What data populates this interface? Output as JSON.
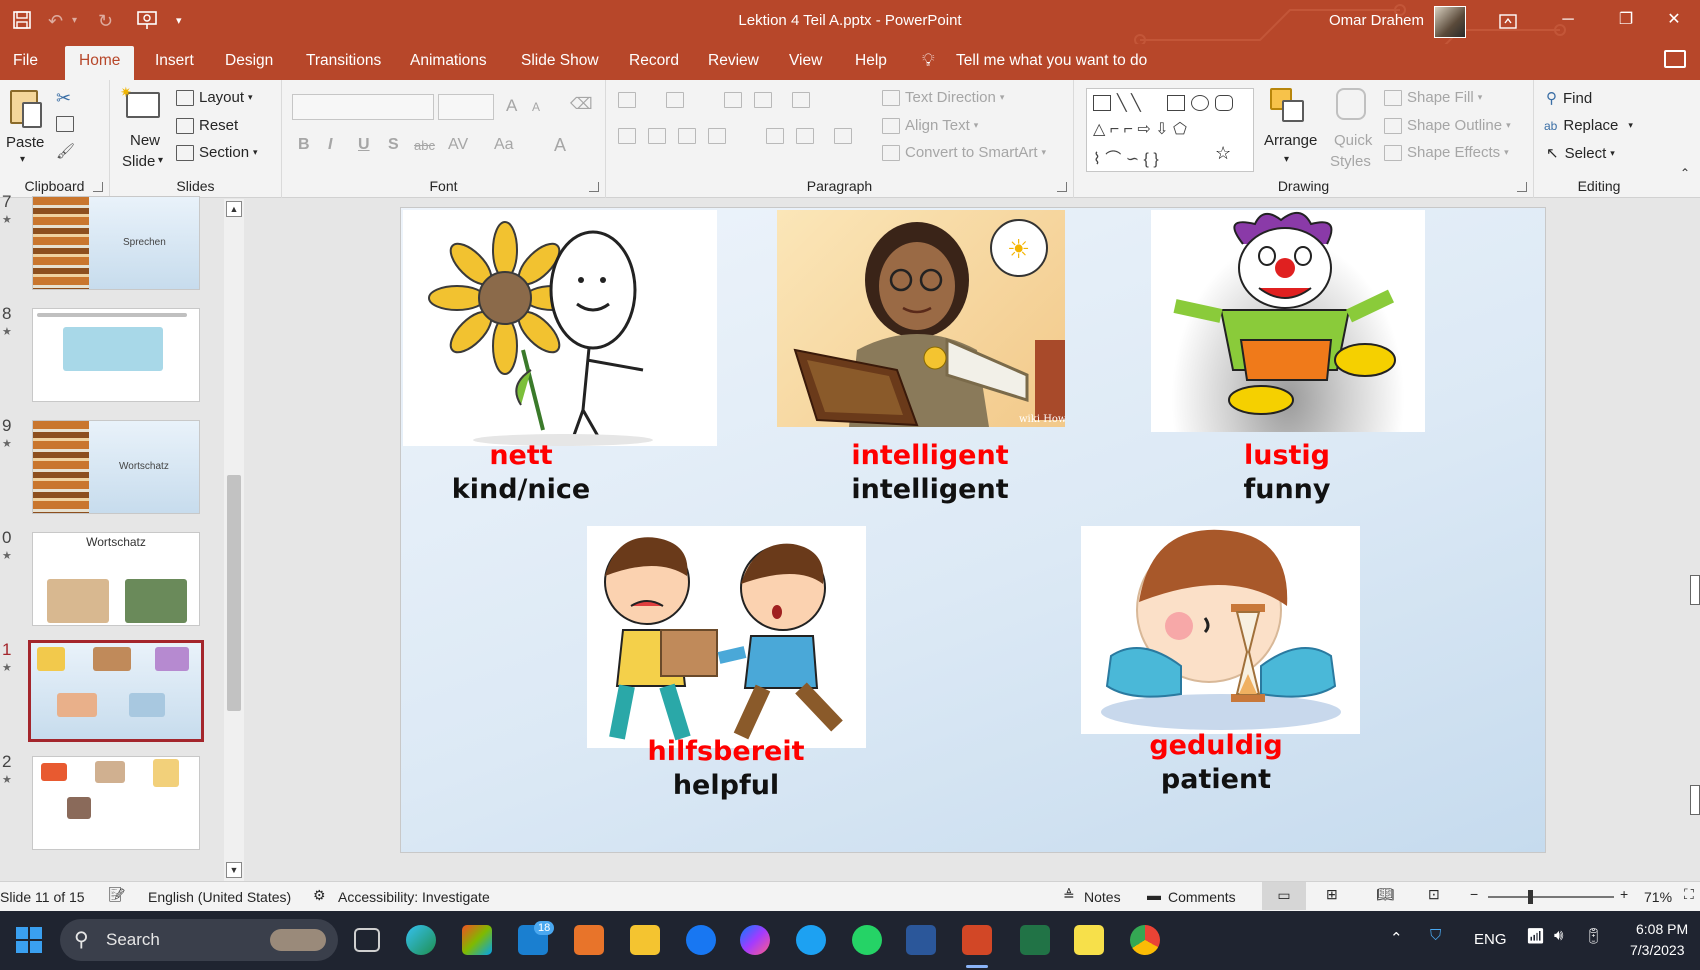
{
  "app": {
    "window_title": "Lektion 4 Teil A.pptx  -  PowerPoint",
    "user_name": "Omar Drahem"
  },
  "quick_access": {
    "save_icon": "save-icon",
    "undo_icon": "undo-icon",
    "redo_icon": "redo-icon",
    "present_icon": "present-from-beginning-icon",
    "customize_glyph": "▾"
  },
  "tabs": [
    "File",
    "Home",
    "Insert",
    "Design",
    "Transitions",
    "Animations",
    "Slide Show",
    "Record",
    "Review",
    "View",
    "Help"
  ],
  "tell_me": "Tell me what you want to do",
  "ribbon": {
    "clipboard": {
      "label": "Clipboard",
      "paste": "Paste"
    },
    "slides": {
      "label": "Slides",
      "new_slide_1": "New",
      "new_slide_2": "Slide",
      "layout": "Layout",
      "reset": "Reset",
      "section": "Section"
    },
    "font": {
      "label": "Font",
      "bold": "B",
      "italic": "I",
      "underline": "U",
      "shadow": "S",
      "strike": "abc",
      "spacing": "AV",
      "case": "Aa",
      "color": "A",
      "grow": "A",
      "shrink": "A"
    },
    "paragraph": {
      "label": "Paragraph",
      "text_direction": "Text Direction",
      "align_text": "Align Text",
      "smartart": "Convert to SmartArt"
    },
    "drawing": {
      "label": "Drawing",
      "arrange": "Arrange",
      "quick_1": "Quick",
      "quick_2": "Styles",
      "shape_fill": "Shape Fill",
      "shape_outline": "Shape Outline",
      "shape_effects": "Shape Effects"
    },
    "editing": {
      "label": "Editing",
      "find": "Find",
      "replace": "Replace",
      "select": "Select"
    }
  },
  "thumbnails": [
    {
      "num": "7",
      "star": "★",
      "title": "",
      "text": "Sprechen"
    },
    {
      "num": "8",
      "star": "★",
      "title": "",
      "text": ""
    },
    {
      "num": "9",
      "star": "★",
      "title": "",
      "text": "Wortschatz"
    },
    {
      "num": "0",
      "star": "★",
      "title": "Wortschatz",
      "text": ""
    },
    {
      "num": "1",
      "star": "★",
      "title": "",
      "text": ""
    },
    {
      "num": "2",
      "star": "★",
      "title": "",
      "text": ""
    }
  ],
  "slide": {
    "items": [
      {
        "de": "nett",
        "en": "kind/nice"
      },
      {
        "de": "intelligent",
        "en": "intelligent"
      },
      {
        "de": "lustig",
        "en": "funny"
      },
      {
        "de": "hilfsbereit",
        "en": "helpful"
      },
      {
        "de": "geduldig",
        "en": "patient"
      }
    ],
    "watermark": "wiki How"
  },
  "status": {
    "slide_of": "Slide 11 of 15",
    "language": "English (United States)",
    "accessibility": "Accessibility: Investigate",
    "notes": "Notes",
    "comments": "Comments",
    "zoom": "71%"
  },
  "taskbar": {
    "search": "Search",
    "mail_badge": "18",
    "lang": "ENG",
    "time": "6:08 PM",
    "date": "7/3/2023"
  }
}
